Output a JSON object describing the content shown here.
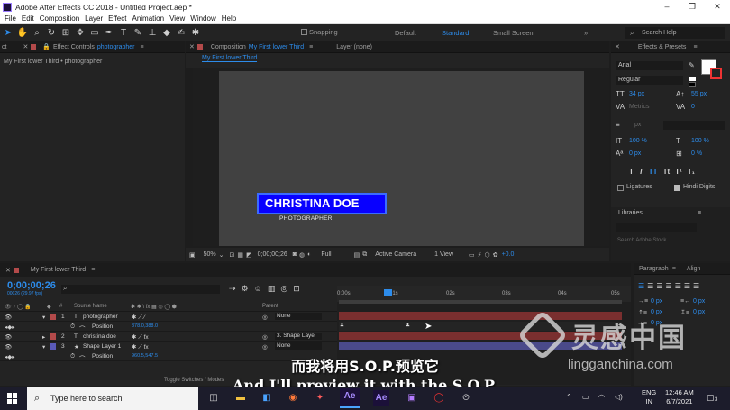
{
  "window": {
    "title": "Adobe After Effects CC 2018 - Untitled Project.aep *",
    "min": "–",
    "max": "❐",
    "close": "✕"
  },
  "menu": [
    "File",
    "Edit",
    "Composition",
    "Layer",
    "Effect",
    "Animation",
    "View",
    "Window",
    "Help"
  ],
  "toolbar": {
    "snapping": "Snapping",
    "workspaces": [
      "Default",
      "Standard",
      "Small Screen"
    ],
    "active_workspace": "Standard",
    "more": "»",
    "search_placeholder": "Search Help"
  },
  "left_panel": {
    "tab_prefix": "Effect Controls",
    "tab_layer": "photographer",
    "breadcrumb": "My First lower Third • photographer"
  },
  "comp_panel": {
    "tab_prefix": "Composition",
    "tab_name": "My First lower Third",
    "layer_tab": "Layer (none)",
    "sub_tab": "My First lower Third",
    "lower_third_name": "CHRISTINA DOE",
    "lower_third_role": "PHOTOGRAPHER",
    "zoom": "50%",
    "timecode": "0;00;00;26",
    "resolution": "Full",
    "camera": "Active Camera",
    "views": "1 View",
    "exposure": "+0.0"
  },
  "effects_panel": {
    "title": "Effects & Presets",
    "font": "Arial",
    "style": "Regular",
    "font_size": "34 px",
    "leading": "55 px",
    "kerning": "Metrics",
    "tracking": "0",
    "stroke_unit": "px",
    "vscale": "100 %",
    "hscale": "100 %",
    "baseline": "0 px",
    "tsume": "0 %",
    "ligatures": "Ligatures",
    "hindi_digits": "Hindi Digits",
    "type_buttons": [
      "T",
      "T",
      "TT",
      "Tt",
      "T¹",
      "T₁"
    ]
  },
  "libraries": {
    "title": "Libraries",
    "search_placeholder": "Search Adobe Stock"
  },
  "paragraph": {
    "title": "Paragraph",
    "align_tab": "Align",
    "indent": [
      "0 px",
      "0 px",
      "0 px",
      "0 px",
      "0 px"
    ]
  },
  "timeline": {
    "comp_tab": "My First lower Third",
    "timecode": "0;00;00;26",
    "subtimecode": "00026 (29.97 fps)",
    "column_source": "Source Name",
    "column_parent": "Parent",
    "toggle": "Toggle Switches / Modes",
    "ruler": [
      "0:00s",
      "01s",
      "02s",
      "03s",
      "04s",
      "05s"
    ],
    "layers": [
      {
        "num": "1",
        "type": "T",
        "name": "photographer",
        "parent": "None",
        "color": "#b34a4a"
      },
      {
        "num": "",
        "type": "",
        "name": "Position",
        "value": "378.0,388.0",
        "parent": "",
        "color": ""
      },
      {
        "num": "2",
        "type": "T",
        "name": "christina doe",
        "parent": "3. Shape Laye",
        "color": "#b34a4a"
      },
      {
        "num": "3",
        "type": "★",
        "name": "Shape Layer 1",
        "parent": "None",
        "color": "#5a5ab8"
      },
      {
        "num": "",
        "type": "",
        "name": "Position",
        "value": "960.5,547.5",
        "parent": "",
        "color": ""
      }
    ]
  },
  "subtitles": {
    "cn": "而我将用S.O.P.预览它",
    "en": "And I'll preview it with the S.O.P."
  },
  "watermark": {
    "cn": "灵感中国",
    "en": "lingganchina.com"
  },
  "taskbar": {
    "search_placeholder": "Type here to search",
    "lang": "ENG",
    "region": "IN",
    "time": "12:46 AM",
    "date": "6/7/2021",
    "notif_count": "3"
  },
  "colors": {
    "accent": "#2d8ceb",
    "lower_third_bg": "#0800ff",
    "layer_red": "#b34a4a",
    "layer_blue": "#5a5ab8"
  }
}
